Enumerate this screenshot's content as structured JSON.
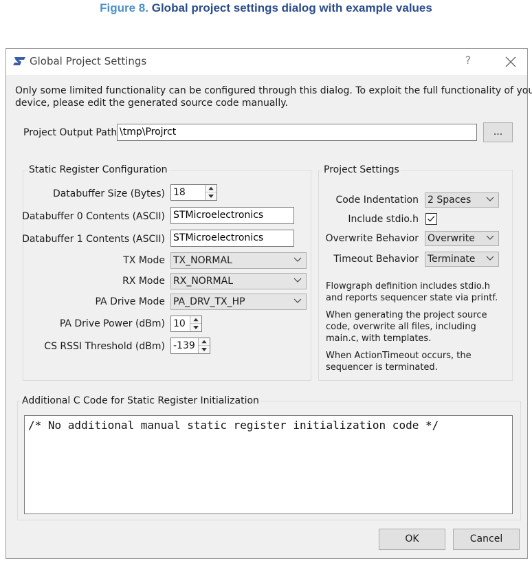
{
  "caption": {
    "figure_label": "Figure 8.",
    "title": "Global project settings dialog with example values"
  },
  "dialog": {
    "title": "Global Project Settings",
    "help_label": "?",
    "intro_line1": "Only some limited functionality can be configured through this dialog. To exploit the full functionality of your",
    "intro_line2": "device, please edit the generated source code manually.",
    "output_path": {
      "label": "Project Output Path:",
      "value": "\\tmp\\Projrct",
      "browse_label": "..."
    },
    "static_register": {
      "title": "Static Register Configuration",
      "databuffer_size": {
        "label": "Databuffer Size (Bytes)",
        "value": "18"
      },
      "databuffer0": {
        "label": "Databuffer 0 Contents (ASCII)",
        "value": "STMicroelectronics"
      },
      "databuffer1": {
        "label": "Databuffer 1 Contents (ASCII)",
        "value": "STMicroelectronics"
      },
      "tx_mode": {
        "label": "TX Mode",
        "value": "TX_NORMAL"
      },
      "rx_mode": {
        "label": "RX Mode",
        "value": "RX_NORMAL"
      },
      "pa_drive_mode": {
        "label": "PA Drive Mode",
        "value": "PA_DRV_TX_HP"
      },
      "pa_drive_power": {
        "label": "PA Drive Power (dBm)",
        "value": "10"
      },
      "cs_rssi": {
        "label": "CS RSSI Threshold (dBm)",
        "value": "-139"
      }
    },
    "project_settings": {
      "title": "Project Settings",
      "code_indentation": {
        "label": "Code Indentation",
        "value": "2 Spaces"
      },
      "include_stdio": {
        "label": "Include stdio.h",
        "checked": true
      },
      "overwrite_behavior": {
        "label": "Overwrite Behavior",
        "value": "Overwrite"
      },
      "timeout_behavior": {
        "label": "Timeout Behavior",
        "value": "Terminate"
      },
      "desc1_line1": "Flowgraph definition includes stdio.h",
      "desc1_line2": "and reports sequencer state via printf.",
      "desc2_line1": "When generating the project source",
      "desc2_line2": "code, overwrite all files, including",
      "desc2_line3": "main.c, with templates.",
      "desc3_line1": "When ActionTimeout occurs, the",
      "desc3_line2": "sequencer is terminated."
    },
    "additional_code": {
      "title": "Additional C Code for Static Register Initialization",
      "value": "/* No additional manual static register initialization code */"
    },
    "ok_label": "OK",
    "cancel_label": "Cancel"
  },
  "colors": {
    "caption_title": "#2a4d8a",
    "caption_label": "#4a90c8",
    "dialog_bg": "#f0f0f0",
    "logo": "#3a5fa8"
  }
}
